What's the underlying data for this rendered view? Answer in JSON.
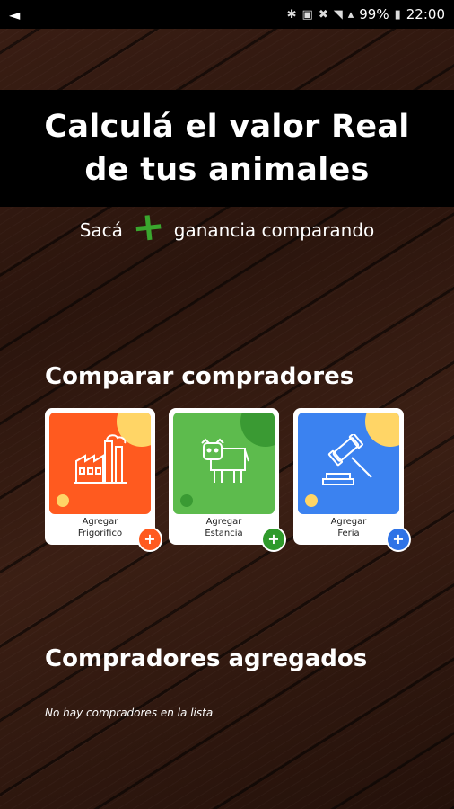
{
  "status_bar": {
    "battery_pct": "99%",
    "time": "22:00"
  },
  "hero": {
    "line1": "Calculá el valor Real",
    "line2": "de tus animales"
  },
  "subtitle": {
    "before": "Sacá",
    "plus_symbol": "+",
    "after": "ganancia comparando"
  },
  "compare_section": {
    "title": "Comparar compradores",
    "cards": [
      {
        "line1": "Agregar",
        "line2": "Frigorifico",
        "color": "#ff5a1f",
        "button_color": "#ff5a1f",
        "icon": "factory-icon"
      },
      {
        "line1": "Agregar",
        "line2": "Estancia",
        "color": "#5dbb4d",
        "button_color": "#2f9a2b",
        "icon": "cow-icon"
      },
      {
        "line1": "Agregar",
        "line2": "Feria",
        "color": "#3b82f0",
        "button_color": "#2f73e6",
        "icon": "gavel-icon"
      }
    ],
    "add_symbol": "+"
  },
  "added_section": {
    "title": "Compradores agregados",
    "empty_text": "No hay compradores en la lista"
  },
  "colors": {
    "hero_bg": "#000000",
    "plus_green": "#3aa62e",
    "yellow_accent": "#ffd566"
  }
}
